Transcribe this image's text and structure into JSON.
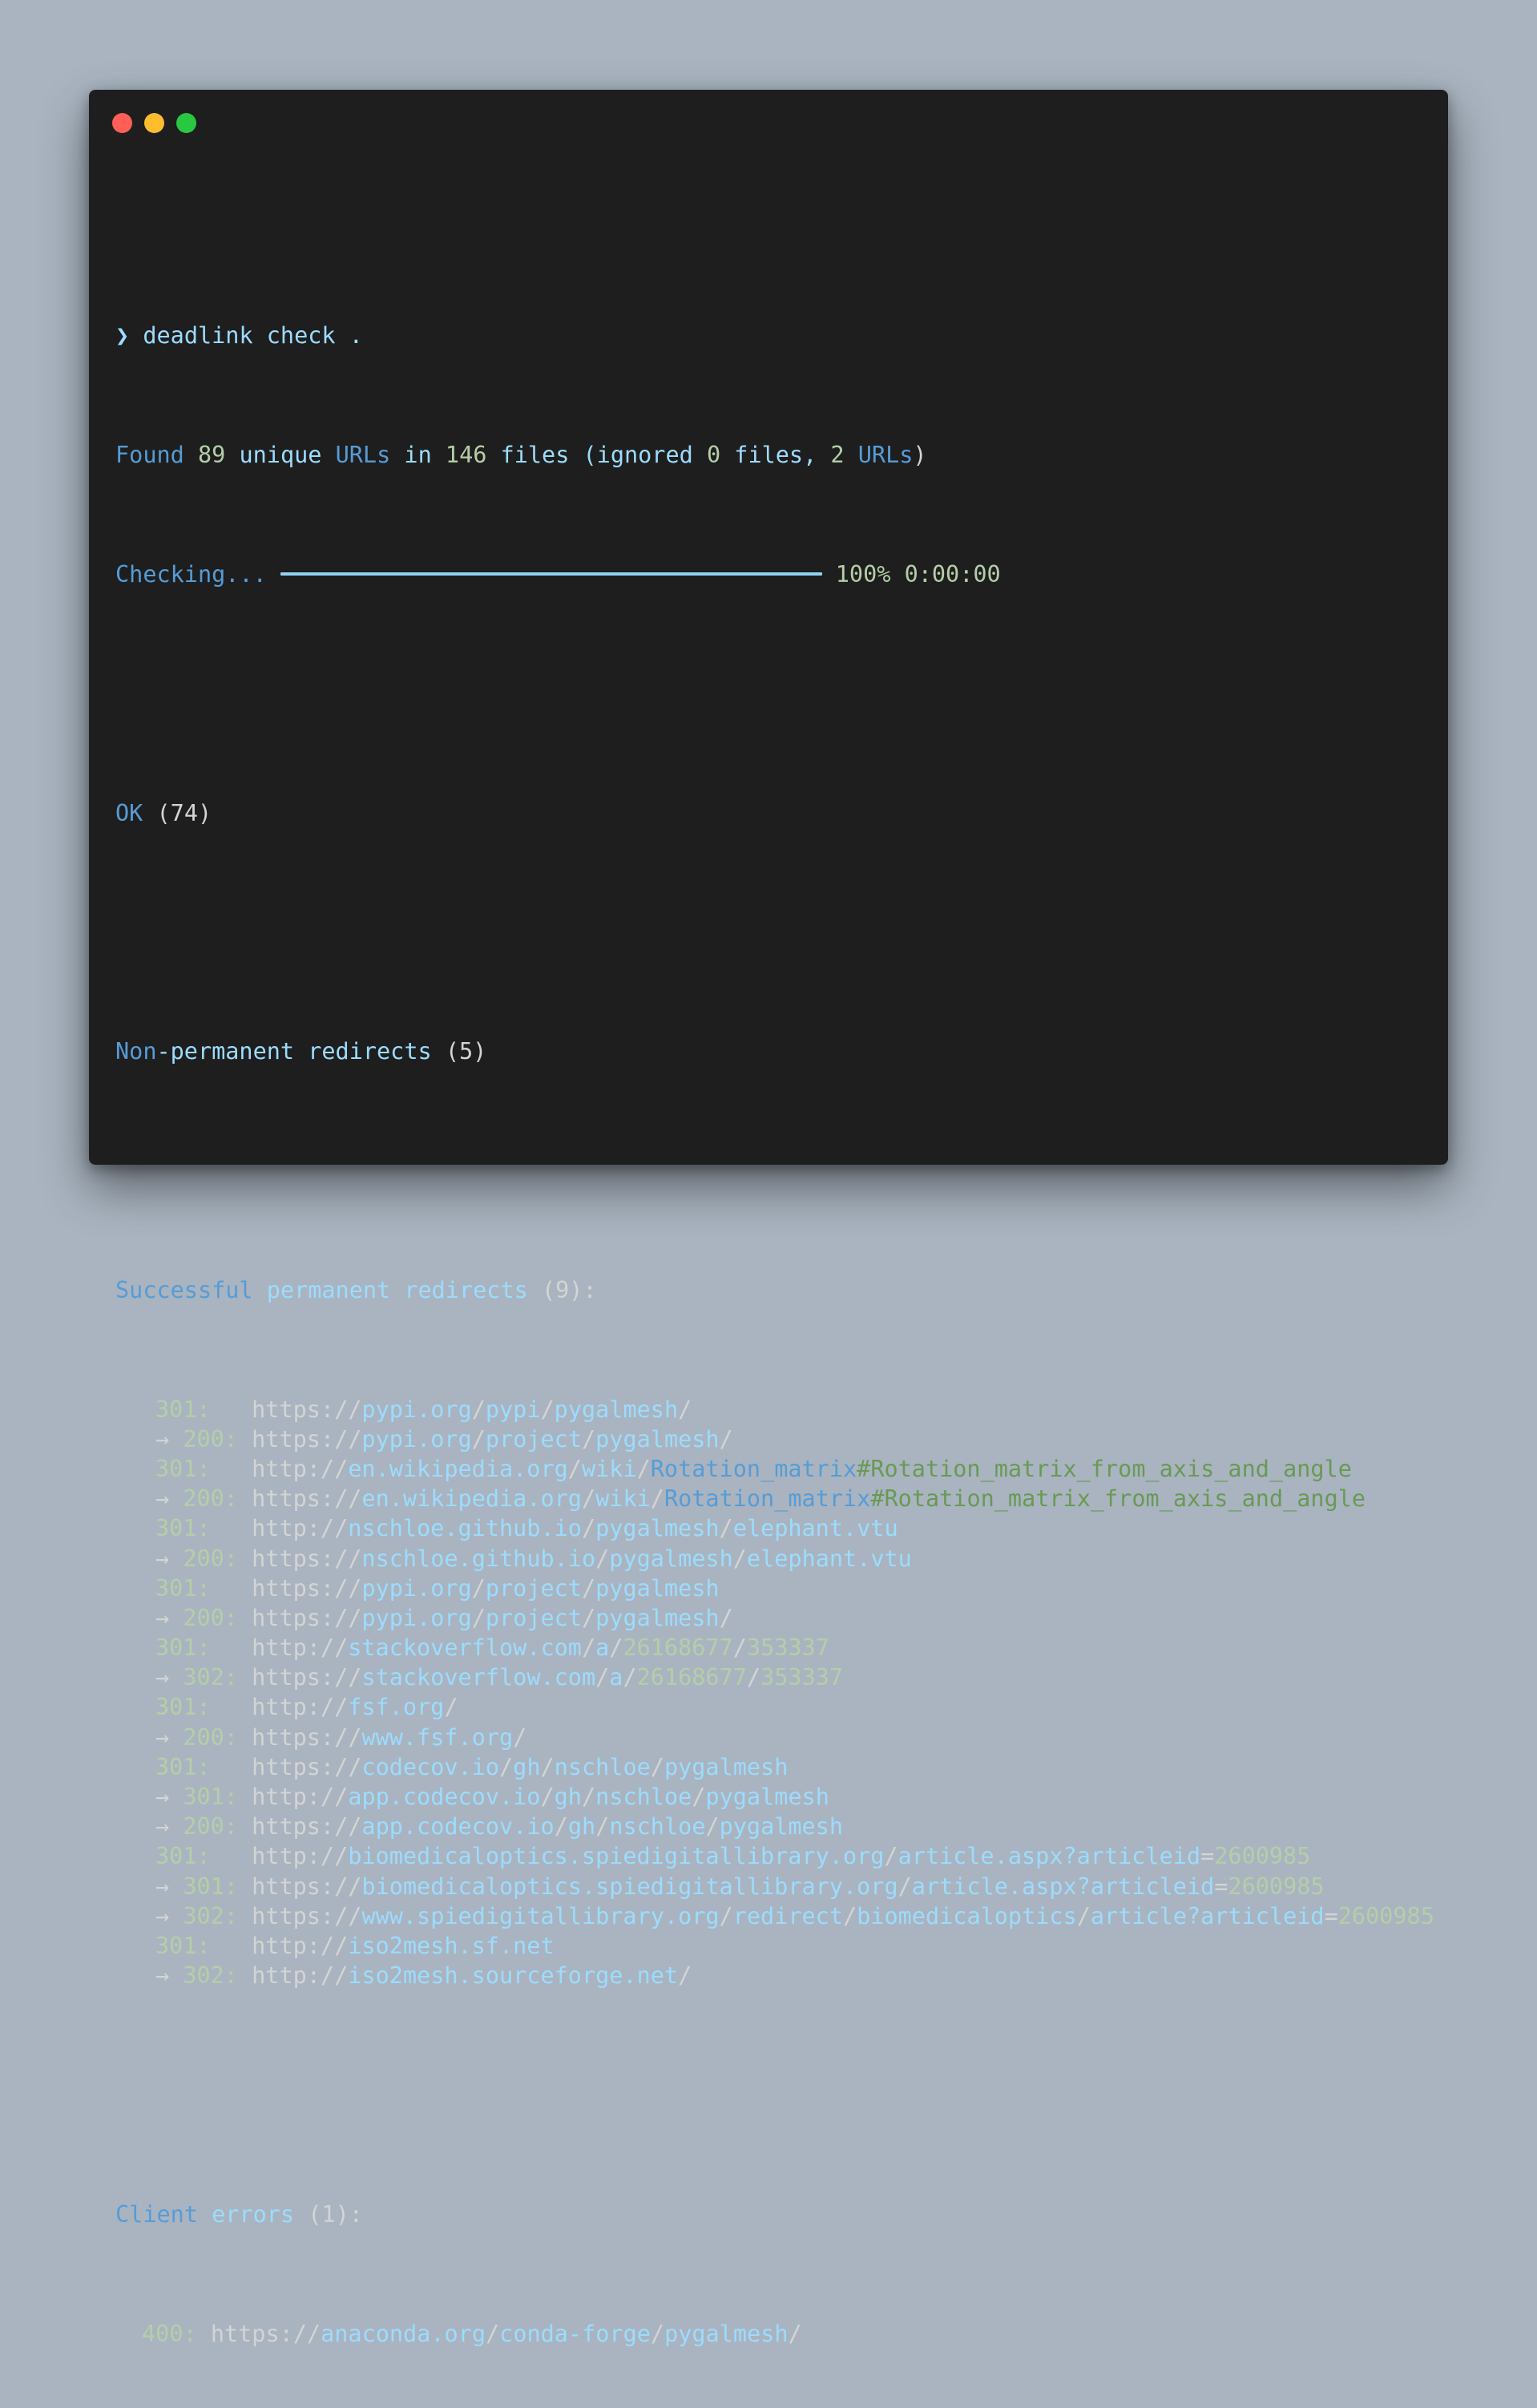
{
  "window": {
    "traffic_lights": [
      "close",
      "minimize",
      "zoom"
    ],
    "colors": {
      "close": "#ff5f57",
      "minimize": "#febc2e",
      "zoom": "#28c840",
      "background": "#1e1e1e"
    }
  },
  "prompt": {
    "symbol": "❯",
    "command": "deadlink check ."
  },
  "summary": {
    "found": "Found",
    "url_count": "89",
    "unique": "unique",
    "urls_word": "URLs",
    "in": "in",
    "file_count": "146",
    "files_paren": "files (ignored",
    "ignored_files": "0",
    "files_comma": "files,",
    "ignored_urls": "2",
    "urls_word2": "URLs",
    "close_paren": ")"
  },
  "progress": {
    "label": "Checking...",
    "fraction": 1.0,
    "percent": "100%",
    "elapsed": "0:00:00"
  },
  "ok": {
    "label": "OK",
    "count": "(74)"
  },
  "non_permanent": {
    "word1": "Non",
    "rest": "-permanent redirects",
    "count": "(5)"
  },
  "successful": {
    "word1": "Successful",
    "rest": "permanent redirects",
    "count": "(9)",
    "colon": ":"
  },
  "redirects": [
    {
      "code": "301:",
      "arrow": false,
      "parts": [
        [
          "t",
          "https://"
        ],
        [
          "lb",
          "pypi.org"
        ],
        [
          "t",
          "/"
        ],
        [
          "lb",
          "pypi"
        ],
        [
          "t",
          "/"
        ],
        [
          "lb",
          "pygalmesh"
        ],
        [
          "t",
          "/"
        ]
      ]
    },
    {
      "code": "200:",
      "arrow": true,
      "parts": [
        [
          "t",
          "https://"
        ],
        [
          "lb",
          "pypi.org"
        ],
        [
          "t",
          "/"
        ],
        [
          "lb",
          "project"
        ],
        [
          "t",
          "/"
        ],
        [
          "lb",
          "pygalmesh"
        ],
        [
          "t",
          "/"
        ]
      ]
    },
    {
      "code": "301:",
      "arrow": false,
      "parts": [
        [
          "t",
          "http://"
        ],
        [
          "lb",
          "en.wikipedia.org"
        ],
        [
          "t",
          "/"
        ],
        [
          "lb",
          "wiki"
        ],
        [
          "t",
          "/"
        ],
        [
          "blue",
          "Rotation_matrix"
        ],
        [
          "green",
          "#Rotation_matrix_from_axis_and_angle"
        ]
      ]
    },
    {
      "code": "200:",
      "arrow": true,
      "parts": [
        [
          "t",
          "https://"
        ],
        [
          "lb",
          "en.wikipedia.org"
        ],
        [
          "t",
          "/"
        ],
        [
          "lb",
          "wiki"
        ],
        [
          "t",
          "/"
        ],
        [
          "blue",
          "Rotation_matrix"
        ],
        [
          "green",
          "#Rotation_matrix_from_axis_and_angle"
        ]
      ]
    },
    {
      "code": "301:",
      "arrow": false,
      "parts": [
        [
          "t",
          "http://"
        ],
        [
          "lb",
          "nschloe.github.io"
        ],
        [
          "t",
          "/"
        ],
        [
          "lb",
          "pygalmesh"
        ],
        [
          "t",
          "/"
        ],
        [
          "lb",
          "elephant.vtu"
        ]
      ]
    },
    {
      "code": "200:",
      "arrow": true,
      "parts": [
        [
          "t",
          "https://"
        ],
        [
          "lb",
          "nschloe.github.io"
        ],
        [
          "t",
          "/"
        ],
        [
          "lb",
          "pygalmesh"
        ],
        [
          "t",
          "/"
        ],
        [
          "lb",
          "elephant.vtu"
        ]
      ]
    },
    {
      "code": "301:",
      "arrow": false,
      "parts": [
        [
          "t",
          "https://"
        ],
        [
          "lb",
          "pypi.org"
        ],
        [
          "t",
          "/"
        ],
        [
          "lb",
          "project"
        ],
        [
          "t",
          "/"
        ],
        [
          "lb",
          "pygalmesh"
        ]
      ]
    },
    {
      "code": "200:",
      "arrow": true,
      "parts": [
        [
          "t",
          "https://"
        ],
        [
          "lb",
          "pypi.org"
        ],
        [
          "t",
          "/"
        ],
        [
          "lb",
          "project"
        ],
        [
          "t",
          "/"
        ],
        [
          "lb",
          "pygalmesh"
        ],
        [
          "t",
          "/"
        ]
      ]
    },
    {
      "code": "301:",
      "arrow": false,
      "parts": [
        [
          "t",
          "http://"
        ],
        [
          "lb",
          "stackoverflow.com"
        ],
        [
          "t",
          "/"
        ],
        [
          "lb",
          "a"
        ],
        [
          "t",
          "/"
        ],
        [
          "num",
          "26168677"
        ],
        [
          "t",
          "/"
        ],
        [
          "num",
          "353337"
        ]
      ]
    },
    {
      "code": "302:",
      "arrow": true,
      "parts": [
        [
          "t",
          "https://"
        ],
        [
          "lb",
          "stackoverflow.com"
        ],
        [
          "t",
          "/"
        ],
        [
          "lb",
          "a"
        ],
        [
          "t",
          "/"
        ],
        [
          "num",
          "26168677"
        ],
        [
          "t",
          "/"
        ],
        [
          "num",
          "353337"
        ]
      ]
    },
    {
      "code": "301:",
      "arrow": false,
      "parts": [
        [
          "t",
          "http://"
        ],
        [
          "lb",
          "fsf.org"
        ],
        [
          "t",
          "/"
        ]
      ]
    },
    {
      "code": "200:",
      "arrow": true,
      "parts": [
        [
          "t",
          "https://"
        ],
        [
          "lb",
          "www.fsf.org"
        ],
        [
          "t",
          "/"
        ]
      ]
    },
    {
      "code": "301:",
      "arrow": false,
      "parts": [
        [
          "t",
          "https://"
        ],
        [
          "lb",
          "codecov.io"
        ],
        [
          "t",
          "/"
        ],
        [
          "lb",
          "gh"
        ],
        [
          "t",
          "/"
        ],
        [
          "lb",
          "nschloe"
        ],
        [
          "t",
          "/"
        ],
        [
          "lb",
          "pygalmesh"
        ]
      ]
    },
    {
      "code": "301:",
      "arrow": true,
      "parts": [
        [
          "t",
          "http://"
        ],
        [
          "lb",
          "app.codecov.io"
        ],
        [
          "t",
          "/"
        ],
        [
          "lb",
          "gh"
        ],
        [
          "t",
          "/"
        ],
        [
          "lb",
          "nschloe"
        ],
        [
          "t",
          "/"
        ],
        [
          "lb",
          "pygalmesh"
        ]
      ]
    },
    {
      "code": "200:",
      "arrow": true,
      "parts": [
        [
          "t",
          "https://"
        ],
        [
          "lb",
          "app.codecov.io"
        ],
        [
          "t",
          "/"
        ],
        [
          "lb",
          "gh"
        ],
        [
          "t",
          "/"
        ],
        [
          "lb",
          "nschloe"
        ],
        [
          "t",
          "/"
        ],
        [
          "lb",
          "pygalmesh"
        ]
      ]
    },
    {
      "code": "301:",
      "arrow": false,
      "parts": [
        [
          "t",
          "http://"
        ],
        [
          "lb",
          "biomedicaloptics.spiedigitallibrary.org"
        ],
        [
          "t",
          "/"
        ],
        [
          "lb",
          "article.aspx?articleid"
        ],
        [
          "t",
          "="
        ],
        [
          "num",
          "2600985"
        ]
      ]
    },
    {
      "code": "301:",
      "arrow": true,
      "parts": [
        [
          "t",
          "https://"
        ],
        [
          "lb",
          "biomedicaloptics.spiedigitallibrary.org"
        ],
        [
          "t",
          "/"
        ],
        [
          "lb",
          "article.aspx?articleid"
        ],
        [
          "t",
          "="
        ],
        [
          "num",
          "2600985"
        ]
      ]
    },
    {
      "code": "302:",
      "arrow": true,
      "parts": [
        [
          "t",
          "https://"
        ],
        [
          "lb",
          "www.spiedigitallibrary.org"
        ],
        [
          "t",
          "/"
        ],
        [
          "lb",
          "redirect"
        ],
        [
          "t",
          "/"
        ],
        [
          "lb",
          "biomedicaloptics"
        ],
        [
          "t",
          "/"
        ],
        [
          "lb",
          "article?articleid"
        ],
        [
          "t",
          "="
        ],
        [
          "num",
          "2600985"
        ]
      ]
    },
    {
      "code": "301:",
      "arrow": false,
      "parts": [
        [
          "t",
          "http://"
        ],
        [
          "lb",
          "iso2mesh.sf.net"
        ]
      ]
    },
    {
      "code": "302:",
      "arrow": true,
      "parts": [
        [
          "t",
          "http://"
        ],
        [
          "lb",
          "iso2mesh.sourceforge.net"
        ],
        [
          "t",
          "/"
        ]
      ]
    }
  ],
  "client_errors": {
    "word1": "Client",
    "rest": "errors",
    "count": "(1)",
    "colon": ":",
    "items": [
      {
        "code": "400:",
        "parts": [
          [
            "t",
            "https://"
          ],
          [
            "lb",
            "anaconda.org"
          ],
          [
            "t",
            "/"
          ],
          [
            "lb",
            "conda-forge"
          ],
          [
            "t",
            "/"
          ],
          [
            "lb",
            "pygalmesh"
          ],
          [
            "t",
            "/"
          ]
        ]
      }
    ]
  }
}
